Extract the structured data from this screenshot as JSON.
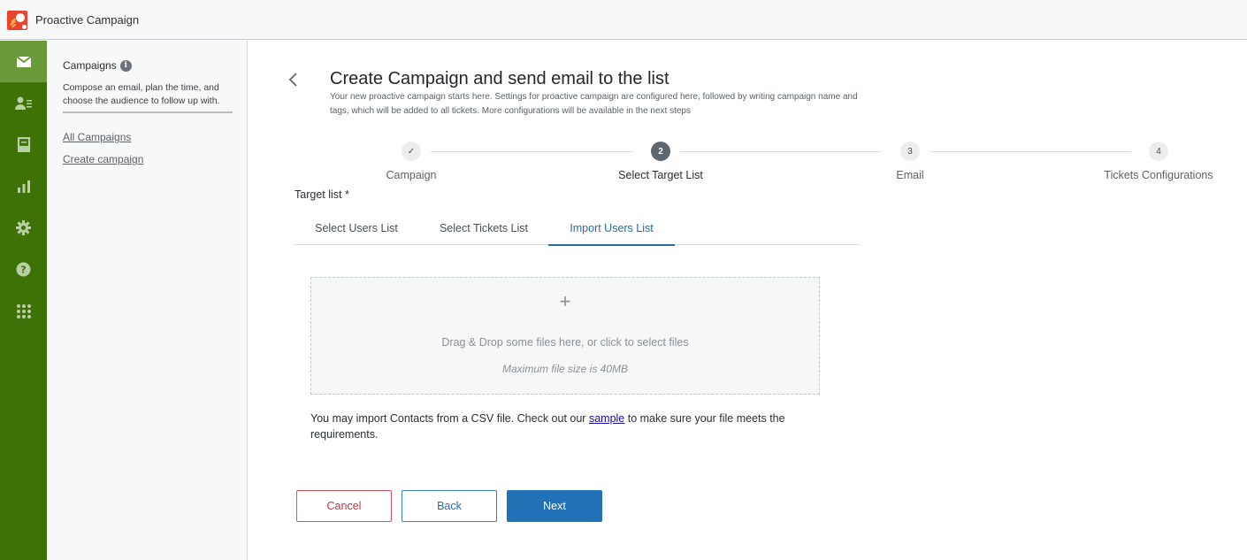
{
  "app": {
    "title": "Proactive Campaign"
  },
  "rail": {
    "items": [
      {
        "name": "email",
        "icon": "envelope-icon",
        "active": true
      },
      {
        "name": "contacts",
        "icon": "contact-list-icon",
        "active": false
      },
      {
        "name": "tickets",
        "icon": "inbox-tray-icon",
        "active": false
      },
      {
        "name": "reports",
        "icon": "bar-chart-icon",
        "active": false
      },
      {
        "name": "settings",
        "icon": "gear-icon",
        "active": false
      },
      {
        "name": "help",
        "icon": "question-circle-icon",
        "active": false
      },
      {
        "name": "apps",
        "icon": "grid-dots-icon",
        "active": false
      }
    ],
    "colors": {
      "background": "#3f7206",
      "active": "#6a9a3a"
    }
  },
  "subnav": {
    "title": "Campaigns",
    "description": "Compose an email, plan the time, and choose the audience to follow up with.",
    "links": [
      {
        "label": "All Campaigns"
      },
      {
        "label": "Create campaign"
      }
    ]
  },
  "page": {
    "title": "Create Campaign and send email to the list",
    "description": "Your new proactive campaign starts here. Settings for proactive campaign are configured here, followed by writing campaign name and tags, which will be added to all tickets. More configurations will be available in the next steps"
  },
  "stepper": {
    "steps": [
      {
        "number": "1",
        "label": "Campaign",
        "state": "completed",
        "glyph": "✓"
      },
      {
        "number": "2",
        "label": "Select Target List",
        "state": "current"
      },
      {
        "number": "3",
        "label": "Email",
        "state": "upcoming"
      },
      {
        "number": "4",
        "label": "Tickets Configurations",
        "state": "upcoming"
      }
    ]
  },
  "target_list": {
    "label": "Target list *",
    "tabs": [
      {
        "label": "Select Users List",
        "active": false
      },
      {
        "label": "Select Tickets List",
        "active": false
      },
      {
        "label": "Import Users List",
        "active": true
      }
    ]
  },
  "dropzone": {
    "plus": "+",
    "text": "Drag & Drop some files here, or click to select files",
    "max_size": "Maximum file size is 40MB"
  },
  "import_note": {
    "before": "You may import Contacts from a CSV file. Check out our ",
    "link": "sample",
    "after": " to make sure your file meets the requirements."
  },
  "buttons": {
    "cancel": "Cancel",
    "back": "Back",
    "next": "Next"
  },
  "colors": {
    "primary": "#2270b6",
    "danger": "#c5384a",
    "link": "#1a0dab"
  }
}
